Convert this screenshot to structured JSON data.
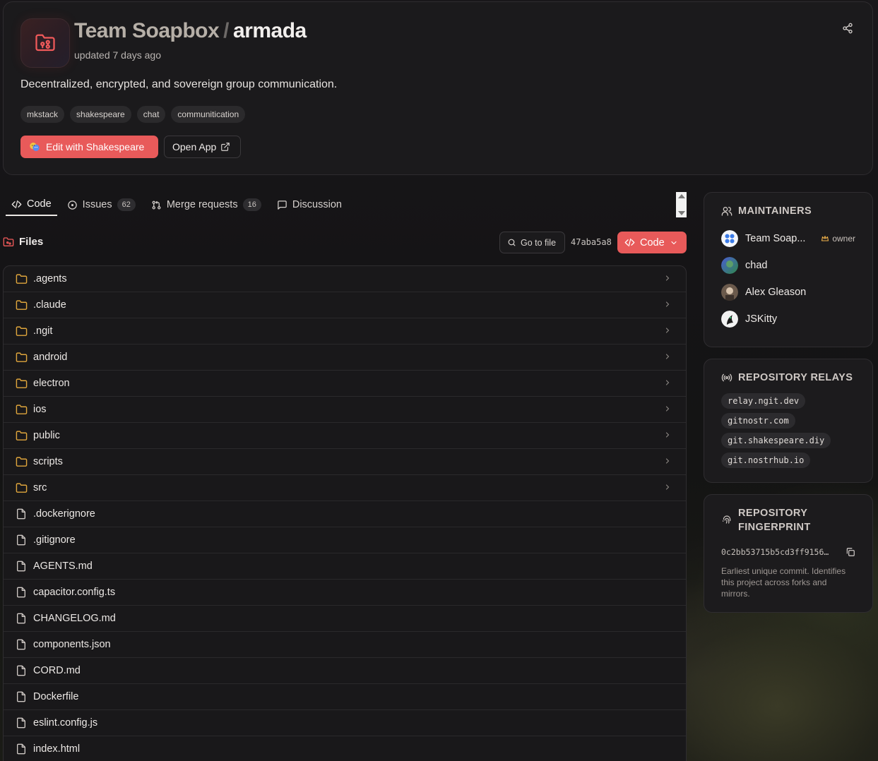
{
  "header": {
    "owner": "Team Soapbox",
    "separator": "/",
    "repo_name": "armada",
    "updated": "updated 7 days ago",
    "description": "Decentralized, encrypted, and sovereign group communication.",
    "tags": [
      "mkstack",
      "shakespeare",
      "chat",
      "communitication"
    ],
    "edit_button": "Edit with Shakespeare",
    "open_app_button": "Open App",
    "accent_color": "#e85a5a"
  },
  "tabs": [
    {
      "label": "Code",
      "icon": "code-icon",
      "count": ""
    },
    {
      "label": "Issues",
      "icon": "issue-circle-icon",
      "count": "62"
    },
    {
      "label": "Merge requests",
      "icon": "merge-request-icon",
      "count": "16"
    },
    {
      "label": "Discussion",
      "icon": "chat-bubble-icon",
      "count": ""
    }
  ],
  "files_bar": {
    "title": "Files",
    "goto_file": "Go to file",
    "commit": "47aba5a8",
    "code_button": "Code"
  },
  "files": [
    {
      "name": ".agents",
      "type": "folder"
    },
    {
      "name": ".claude",
      "type": "folder"
    },
    {
      "name": ".ngit",
      "type": "folder"
    },
    {
      "name": "android",
      "type": "folder"
    },
    {
      "name": "electron",
      "type": "folder"
    },
    {
      "name": "ios",
      "type": "folder"
    },
    {
      "name": "public",
      "type": "folder"
    },
    {
      "name": "scripts",
      "type": "folder"
    },
    {
      "name": "src",
      "type": "folder"
    },
    {
      "name": ".dockerignore",
      "type": "file"
    },
    {
      "name": ".gitignore",
      "type": "file"
    },
    {
      "name": "AGENTS.md",
      "type": "file"
    },
    {
      "name": "capacitor.config.ts",
      "type": "file"
    },
    {
      "name": "CHANGELOG.md",
      "type": "file"
    },
    {
      "name": "components.json",
      "type": "file"
    },
    {
      "name": "CORD.md",
      "type": "file"
    },
    {
      "name": "Dockerfile",
      "type": "file"
    },
    {
      "name": "eslint.config.js",
      "type": "file"
    },
    {
      "name": "index.html",
      "type": "file"
    }
  ],
  "maintainers": {
    "title": "MAINTAINERS",
    "people": [
      {
        "name": "Team Soap...",
        "badge": "owner"
      },
      {
        "name": "chad",
        "badge": ""
      },
      {
        "name": "Alex Gleason",
        "badge": ""
      },
      {
        "name": "JSKitty",
        "badge": ""
      }
    ]
  },
  "relays": {
    "title": "REPOSITORY RELAYS",
    "items": [
      "relay.ngit.dev",
      "gitnostr.com",
      "git.shakespeare.diy",
      "git.nostrhub.io"
    ]
  },
  "fingerprint": {
    "title_line1": "REPOSITORY",
    "title_line2": "FINGERPRINT",
    "value": "0c2bb53715b5cd3ff9156…",
    "note": "Earliest unique commit. Identifies this project across forks and mirrors."
  }
}
